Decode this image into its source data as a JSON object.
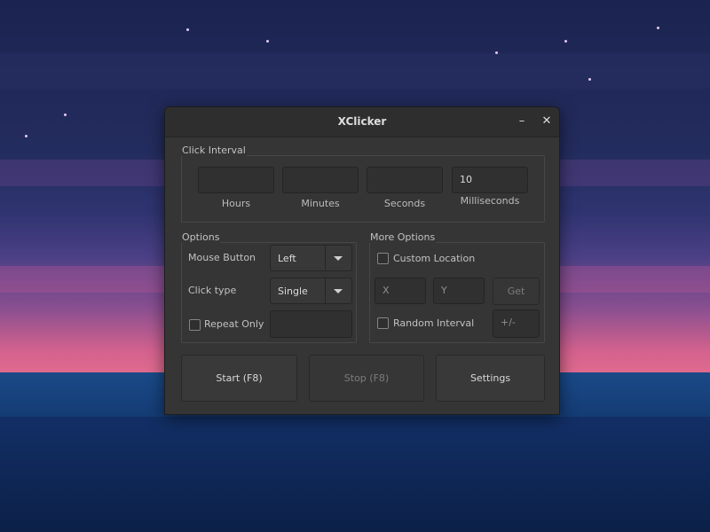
{
  "window": {
    "title": "XClicker",
    "minimize_glyph": "–",
    "close_glyph": "✕"
  },
  "click_interval": {
    "label": "Click Interval",
    "fields": [
      {
        "caption": "Hours",
        "value": ""
      },
      {
        "caption": "Minutes",
        "value": ""
      },
      {
        "caption": "Seconds",
        "value": ""
      },
      {
        "caption": "Milliseconds",
        "value": "10"
      }
    ]
  },
  "options": {
    "label": "Options",
    "mouse_button_label": "Mouse Button",
    "mouse_button_value": "Left",
    "click_type_label": "Click type",
    "click_type_value": "Single",
    "repeat_only_label": "Repeat Only",
    "repeat_only_checked": false,
    "repeat_only_value": ""
  },
  "more_options": {
    "label": "More Options",
    "custom_location_label": "Custom Location",
    "custom_location_checked": false,
    "x_placeholder": "X",
    "y_placeholder": "Y",
    "get_label": "Get",
    "random_interval_label": "Random Interval",
    "random_interval_checked": false,
    "random_placeholder": "+/-"
  },
  "buttons": {
    "start": "Start (F8)",
    "stop": "Stop (F8)",
    "settings": "Settings"
  }
}
